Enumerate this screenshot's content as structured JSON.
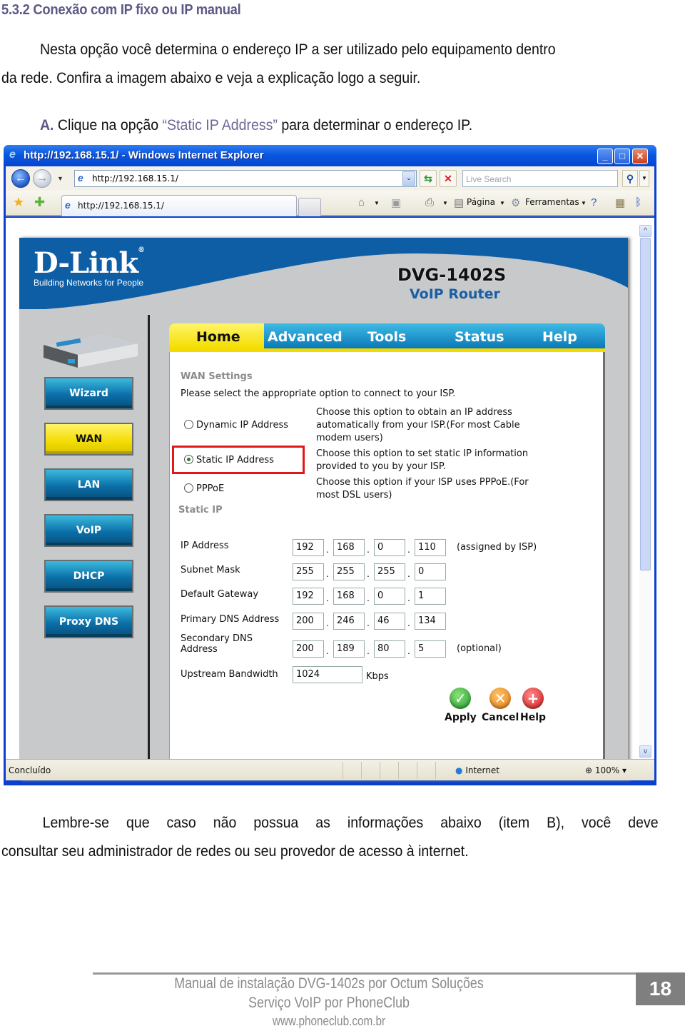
{
  "document": {
    "heading": "5.3.2 Conexão com IP fixo ou IP manual",
    "intro_line1": "Nesta opção você determina o endereço IP a ser utilizado pelo equipamento dentro",
    "intro_line2": "da rede. Confira a imagem abaixo e veja a explicação logo a seguir.",
    "step_label": "A.",
    "step_text_before": "Clique na opção",
    "step_highlight": "“Static IP Address”",
    "step_text_after": "para determinar o endereço IP.",
    "note_line1_words": [
      "Lembre-se",
      "que",
      "caso",
      "não",
      "possua",
      "as",
      "informações",
      "abaixo",
      "(item",
      "B),",
      "você",
      "deve"
    ],
    "note_line2": "consultar seu administrador de redes ou seu provedor de acesso à internet."
  },
  "browser": {
    "title": "http://192.168.15.1/ - Windows Internet Explorer",
    "address": "http://192.168.15.1/",
    "search_placeholder": "Live Search",
    "tab_label": "http://192.168.15.1/",
    "commands": {
      "page": "Página",
      "tools": "Ferramentas"
    },
    "status": "Concluído",
    "zone": "Internet",
    "zoom": "100%"
  },
  "router": {
    "brand": "D-Link",
    "tagline": "Building Networks for People",
    "model": "DVG-1402S",
    "subtitle": "VoIP Router",
    "tabs": [
      "Home",
      "Advanced",
      "Tools",
      "Status",
      "Help"
    ],
    "active_tab": "Home",
    "sidebar": [
      "Wizard",
      "WAN",
      "LAN",
      "VoIP",
      "DHCP",
      "Proxy DNS"
    ],
    "active_sidebar": "WAN",
    "wan": {
      "title": "WAN Settings",
      "prompt": "Please select the appropriate option to connect to your ISP.",
      "options": [
        {
          "label": "Dynamic IP Address",
          "desc": "Choose this option to obtain an IP address automatically from your ISP.(For most Cable modem users)",
          "selected": false
        },
        {
          "label": "Static IP Address",
          "desc": "Choose this option to set static IP information provided to you by your ISP.",
          "selected": true
        },
        {
          "label": "PPPoE",
          "desc": "Choose this option if your ISP uses PPPoE.(For most DSL users)",
          "selected": false
        }
      ],
      "static_title": "Static IP",
      "fields": [
        {
          "label": "IP Address",
          "octets": [
            "192",
            "168",
            "0",
            "110"
          ],
          "note": "(assigned by ISP)"
        },
        {
          "label": "Subnet Mask",
          "octets": [
            "255",
            "255",
            "255",
            "0"
          ],
          "note": ""
        },
        {
          "label": "Default Gateway",
          "octets": [
            "192",
            "168",
            "0",
            "1"
          ],
          "note": ""
        },
        {
          "label": "Primary DNS Address",
          "octets": [
            "200",
            "246",
            "46",
            "134"
          ],
          "note": ""
        },
        {
          "label": "Secondary DNS Address",
          "octets": [
            "200",
            "189",
            "80",
            "5"
          ],
          "note": "(optional)"
        }
      ],
      "bandwidth_label": "Upstream Bandwidth",
      "bandwidth_value": "1024",
      "bandwidth_unit": "Kbps",
      "actions": [
        "Apply",
        "Cancel",
        "Help"
      ]
    }
  },
  "footer": {
    "line1": "Manual de instalação DVG-1402s por Octum Soluções",
    "line2": "Serviço VoIP por PhoneClub",
    "line3": "www.phoneclub.com.br",
    "page_number": "18"
  }
}
